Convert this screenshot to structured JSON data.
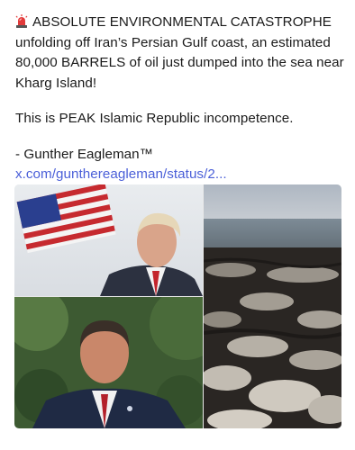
{
  "post": {
    "icons": {
      "alert": "police-light-icon"
    },
    "lines": [
      "ABSOLUTE ENVIRONMENTAL CATASTROPHE",
      "unfolding off Iran’s Persian Gulf coast, an estimated",
      "80,000 BARRELS of oil just dumped into the sea near",
      "Kharg Island!",
      "This is PEAK Islamic Republic incompetence.",
      "- Gunther Eagleman™"
    ],
    "link_text": "x.com/gunthereagleman/status/2..."
  },
  "media": {
    "images": [
      {
        "depicts": "man in suit with American flag"
      },
      {
        "depicts": "man in suit with red tie outdoors"
      },
      {
        "depicts": "oil-covered rocky shoreline"
      }
    ]
  },
  "colors": {
    "text": "#1a1a1a",
    "link": "#4a5fd8",
    "background": "#ffffff"
  }
}
